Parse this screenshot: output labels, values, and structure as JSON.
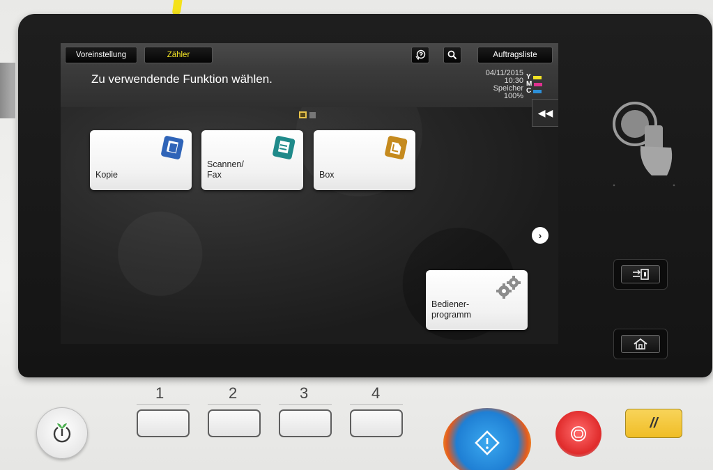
{
  "header": {
    "preset_label": "Voreinstellung",
    "counter_label": "Zähler",
    "job_list_label": "Auftragsliste",
    "prompt": "Zu verwendende Funktion wählen.",
    "date": "04/11/2015",
    "time": "10:30",
    "memory_label": "Speicher",
    "memory_value": "100%",
    "toner": [
      {
        "letter": "Y",
        "color": "#f2e324"
      },
      {
        "letter": "M",
        "color": "#e0308f"
      },
      {
        "letter": "C",
        "color": "#2d8fd8"
      }
    ],
    "icons": [
      "guidance-icon",
      "search-icon"
    ]
  },
  "functions": [
    {
      "label": "Kopie",
      "icon": "copy-icon",
      "color": "#2f64b8"
    },
    {
      "label": "Scannen/\nFax",
      "icon": "scan-fax-icon",
      "color": "#1f8a8a"
    },
    {
      "label": "Box",
      "icon": "box-icon",
      "color": "#c58a1e"
    },
    {
      "label": "Bediener-\nprogramm",
      "icon": "gear-icon",
      "color": "#8c8c8c"
    }
  ],
  "pager": {
    "current": 1,
    "total": 2
  },
  "panel": {
    "number_keys": [
      "1",
      "2",
      "3",
      "4"
    ],
    "reset_symbol": "//"
  }
}
